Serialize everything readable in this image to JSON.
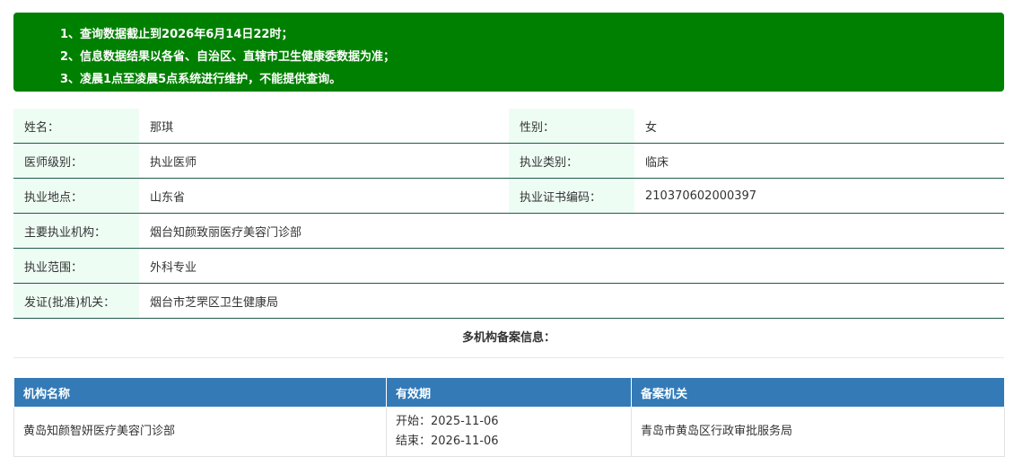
{
  "notice": {
    "items": [
      "1、查询数据截止到2026年6月14日22时；",
      "2、信息数据结果以各省、自治区、直辖市卫生健康委数据为准；",
      "3、凌晨1点至凌晨5点系统进行维护，不能提供查询。"
    ]
  },
  "doctor": {
    "name_label": "姓名：",
    "name": "那琪",
    "gender_label": "性别：",
    "gender": "女",
    "level_label": "医师级别：",
    "level": "执业医师",
    "category_label": "执业类别：",
    "category": "临床",
    "location_label": "执业地点：",
    "location": "山东省",
    "cert_label": "执业证书编码：",
    "cert": "210370602000397",
    "institution_label": "主要执业机构：",
    "institution": "烟台知颜致丽医疗美容门诊部",
    "scope_label": "执业范围：",
    "scope": "外科专业",
    "authority_label": "发证(批准)机关：",
    "authority": "烟台市芝罘区卫生健康局"
  },
  "multi_title": "多机构备案信息：",
  "records": {
    "headers": [
      "机构名称",
      "有效期",
      "备案机关"
    ],
    "rows": [
      {
        "name": "黄岛知颜智妍医疗美容门诊部",
        "start": "开始：2025-11-06",
        "end": "结束：2026-11-06",
        "authority": "青岛市黄岛区行政审批服务局"
      }
    ]
  }
}
